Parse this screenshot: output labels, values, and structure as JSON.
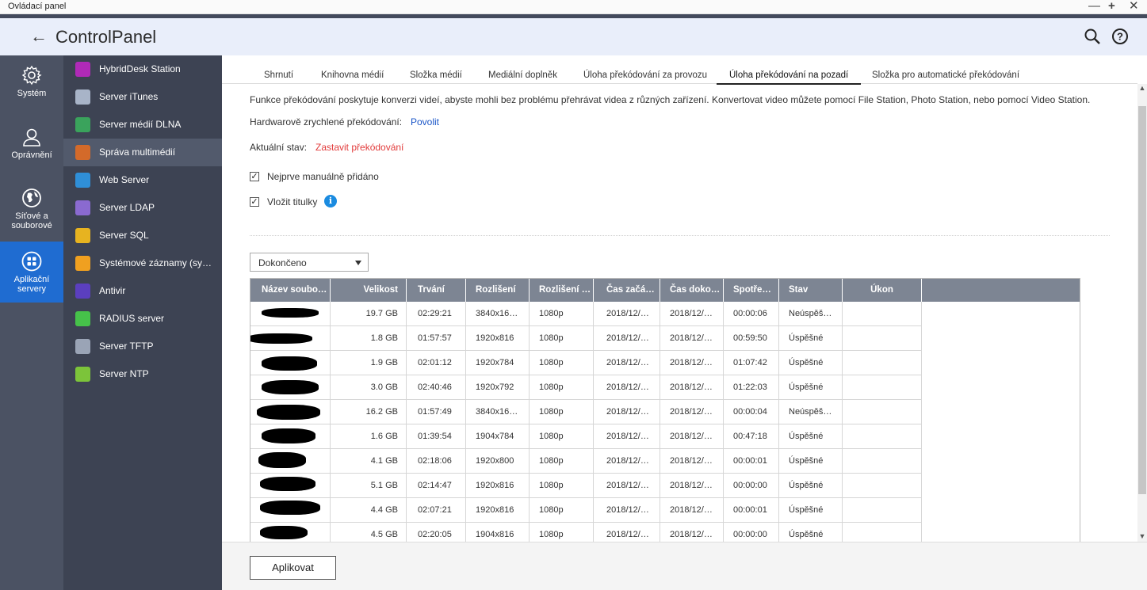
{
  "os": {
    "window_title": "Ovládací panel",
    "minimize": "—",
    "maximize": "+",
    "close": "✕"
  },
  "header": {
    "title_bold": "Control",
    "title_rest": "Panel",
    "icons": [
      "back-arrow-icon",
      "search-icon",
      "help-icon"
    ]
  },
  "rail": [
    {
      "label": "Systém",
      "icon": "gear-icon"
    },
    {
      "label": "Oprávnění",
      "icon": "user-icon"
    },
    {
      "label": "Síťové a souborové",
      "icon": "globe-icon"
    },
    {
      "label": "Aplikační servery",
      "icon": "apps-icon",
      "active": true
    }
  ],
  "sidebar": [
    {
      "label": "HybridDesk Station",
      "color": "#b02ab8"
    },
    {
      "label": "Server iTunes",
      "color": "#a8b4c8"
    },
    {
      "label": "Server médií DLNA",
      "color": "#3aa35c"
    },
    {
      "label": "Správa multimédií",
      "color": "#d36a2a",
      "active": true
    },
    {
      "label": "Web Server",
      "color": "#2f8fd8"
    },
    {
      "label": "Server LDAP",
      "color": "#8a6ad0"
    },
    {
      "label": "Server SQL",
      "color": "#e7b320"
    },
    {
      "label": "Systémové záznamy (sy…",
      "color": "#f0a020"
    },
    {
      "label": "Antivir",
      "color": "#5b3fbf"
    },
    {
      "label": "RADIUS server",
      "color": "#46c24a"
    },
    {
      "label": "Server TFTP",
      "color": "#9aa4b6"
    },
    {
      "label": "Server NTP",
      "color": "#7cc43a"
    }
  ],
  "tabs": [
    "Shrnutí",
    "Knihovna médií",
    "Složka médií",
    "Mediální doplněk",
    "Úloha překódování za provozu",
    "Úloha překódování na pozadí",
    "Složka pro automatické překódování"
  ],
  "active_tab": "Úloha překódování na pozadí",
  "content": {
    "description": "Funkce překódování poskytuje konverzi videí, abyste mohli bez problému přehrávat videa z různých zařízení. Konvertovat video můžete pomocí File Station, Photo Station, nebo pomocí Video Station.",
    "hw_label": "Hardwarově zrychlené překódování:",
    "hw_link": "Povolit",
    "status_label": "Aktuální stav:",
    "status_link": "Zastavit překódování",
    "check1": "Nejprve manuálně přidáno",
    "check2": "Vložit titulky",
    "filter_value": "Dokončeno",
    "apply_label": "Aplikovat"
  },
  "table": {
    "headers": [
      "Název soubo…",
      "Velikost",
      "Trvání",
      "Rozlišení",
      "Rozlišení …",
      "Čas začá…",
      "Čas doko…",
      "Spotře…",
      "Stav",
      "Úkon"
    ],
    "rows": [
      [
        "",
        "19.7 GB",
        "02:29:21",
        "3840x16…",
        "1080p",
        "2018/12/…",
        "2018/12/…",
        "00:00:06",
        "Neúspěš…",
        ""
      ],
      [
        "",
        "1.8 GB",
        "01:57:57",
        "1920x816",
        "1080p",
        "2018/12/…",
        "2018/12/…",
        "00:59:50",
        "Úspěšné",
        ""
      ],
      [
        "",
        "1.9 GB",
        "02:01:12",
        "1920x784",
        "1080p",
        "2018/12/…",
        "2018/12/…",
        "01:07:42",
        "Úspěšné",
        ""
      ],
      [
        "",
        "3.0 GB",
        "02:40:46",
        "1920x792",
        "1080p",
        "2018/12/…",
        "2018/12/…",
        "01:22:03",
        "Úspěšné",
        ""
      ],
      [
        "",
        "16.2 GB",
        "01:57:49",
        "3840x16…",
        "1080p",
        "2018/12/…",
        "2018/12/…",
        "00:00:04",
        "Neúspěš…",
        ""
      ],
      [
        "",
        "1.6 GB",
        "01:39:54",
        "1904x784",
        "1080p",
        "2018/12/…",
        "2018/12/…",
        "00:47:18",
        "Úspěšné",
        ""
      ],
      [
        "",
        "4.1 GB",
        "02:18:06",
        "1920x800",
        "1080p",
        "2018/12/…",
        "2018/12/…",
        "00:00:01",
        "Úspěšné",
        ""
      ],
      [
        "",
        "5.1 GB",
        "02:14:47",
        "1920x816",
        "1080p",
        "2018/12/…",
        "2018/12/…",
        "00:00:00",
        "Úspěšné",
        ""
      ],
      [
        "",
        "4.4 GB",
        "02:07:21",
        "1920x816",
        "1080p",
        "2018/12/…",
        "2018/12/…",
        "00:00:01",
        "Úspěšné",
        ""
      ],
      [
        "",
        "4.5 GB",
        "02:20:05",
        "1904x816",
        "1080p",
        "2018/12/…",
        "2018/12/…",
        "00:00:00",
        "Úspěšné",
        ""
      ]
    ]
  }
}
